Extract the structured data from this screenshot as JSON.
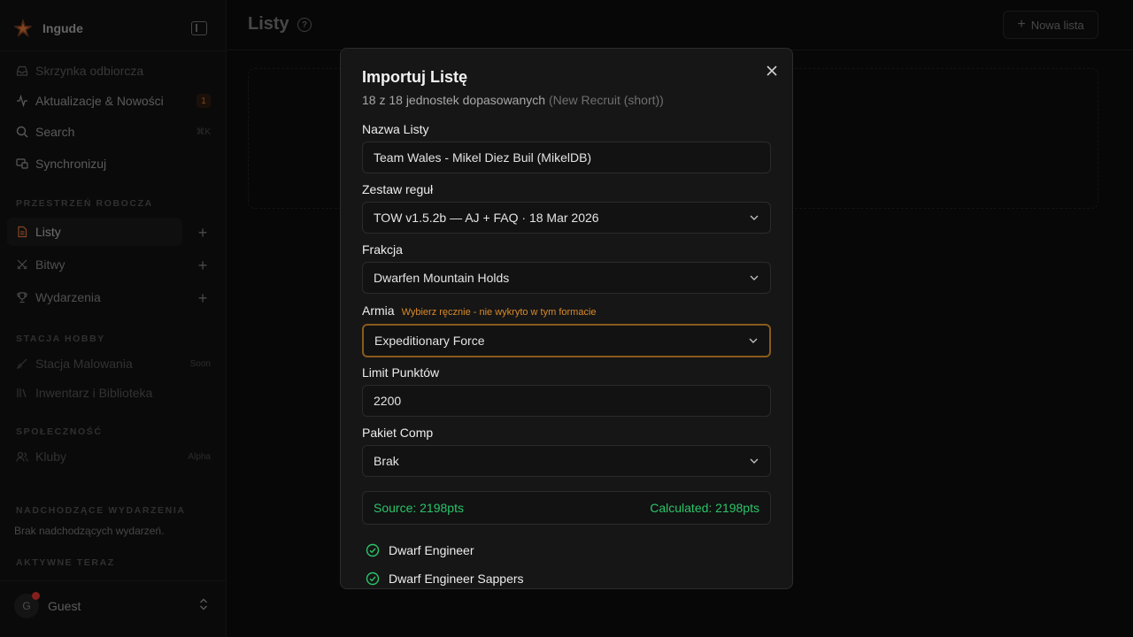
{
  "app": {
    "name": "Ingude"
  },
  "sidebar": {
    "items": [
      {
        "label": "Skrzynka odbiorcza",
        "icon": "inbox-icon"
      },
      {
        "label": "Aktualizacje & Nowości",
        "icon": "activity-icon",
        "badge": "1"
      },
      {
        "label": "Search",
        "icon": "search-icon",
        "shortcut": "⌘K"
      },
      {
        "label": "Synchronizuj",
        "icon": "sync-icon"
      }
    ],
    "workspace_title": "PRZESTRZEŃ ROBOCZA",
    "workspace": [
      {
        "label": "Listy",
        "icon": "document-icon"
      },
      {
        "label": "Bitwy",
        "icon": "swords-icon"
      },
      {
        "label": "Wydarzenia",
        "icon": "trophy-icon"
      }
    ],
    "hobby_title": "STACJA HOBBY",
    "hobby": [
      {
        "label": "Stacja Malowania",
        "icon": "brush-icon",
        "tag": "Soon"
      },
      {
        "label": "Inwentarz i Biblioteka",
        "icon": "library-icon"
      }
    ],
    "community_title": "SPOŁECZNOŚĆ",
    "community": [
      {
        "label": "Kluby",
        "icon": "users-icon",
        "tag": "Alpha"
      }
    ],
    "upcoming_title": "NADCHODZĄCE WYDARZENIA",
    "upcoming_empty": "Brak nadchodzących wydarzeń.",
    "active_title": "AKTYWNE TERAZ"
  },
  "user": {
    "initial": "G",
    "name": "Guest"
  },
  "header": {
    "title": "Listy",
    "new_list": "Nowa lista"
  },
  "modal": {
    "title": "Importuj Listę",
    "subtitle": "18 z 18 jednostek dopasowanych",
    "subtitle_source": "(New Recruit (short))",
    "name_label": "Nazwa Listy",
    "name_value": "Team Wales - Mikel Diez Buil (MikelDB)",
    "ruleset_label": "Zestaw reguł",
    "ruleset_value": "TOW v1.5.2b — AJ + FAQ · 18 Mar 2026",
    "faction_label": "Frakcja",
    "faction_value": "Dwarfen Mountain Holds",
    "army_label": "Armia",
    "army_warning": "Wybierz ręcznie - nie wykryto w tym formacie",
    "army_value": "Expeditionary Force",
    "points_label": "Limit Punktów",
    "points_value": "2200",
    "comp_label": "Pakiet Comp",
    "comp_value": "Brak",
    "source_pts": "Source: 2198pts",
    "calculated_pts": "Calculated: 2198pts",
    "units": [
      "Dwarf Engineer",
      "Dwarf Engineer Sappers"
    ],
    "colors": {
      "accent": "#d98a28",
      "success": "#2bc46a"
    }
  }
}
